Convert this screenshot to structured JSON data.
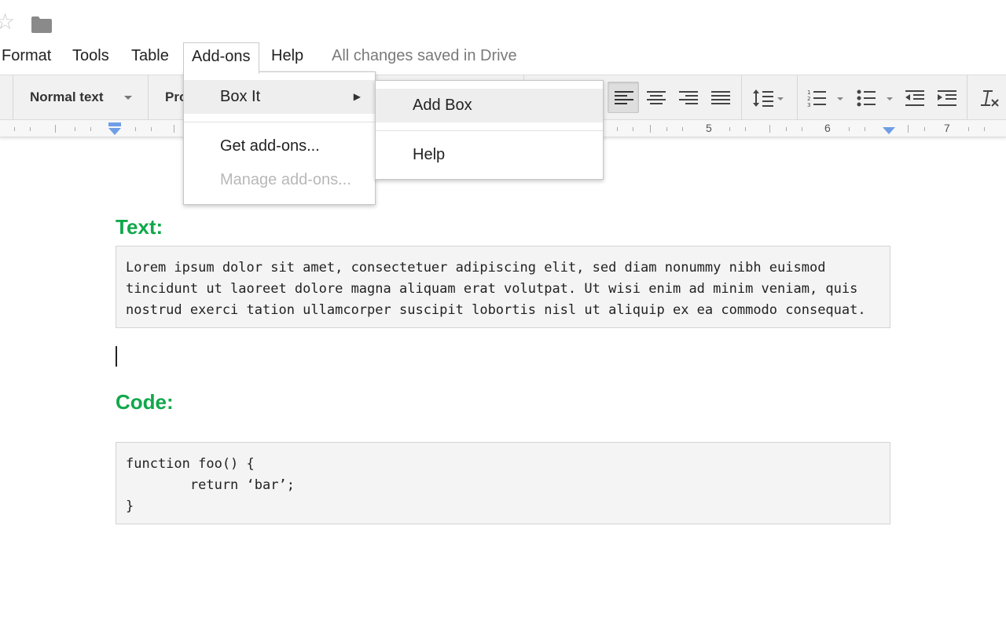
{
  "title_strip": {
    "star_icon": "star-outline-icon",
    "folder_icon": "folder-icon"
  },
  "menubar": {
    "items": [
      {
        "label": "Format"
      },
      {
        "label": "Tools"
      },
      {
        "label": "Table"
      },
      {
        "label": "Add-ons"
      },
      {
        "label": "Help"
      }
    ],
    "active_item": "Add-ons",
    "save_status": "All changes saved in Drive"
  },
  "toolbar": {
    "paragraph_style": "Normal text",
    "font": "Pro",
    "active_alignment": "align-left"
  },
  "ruler": {
    "numbers": [
      "5",
      "6",
      "7"
    ]
  },
  "addons_menu": {
    "items": [
      {
        "label": "Box It",
        "has_submenu": true,
        "highlighted": true
      },
      {
        "label": "Get add-ons..."
      },
      {
        "label": "Manage add-ons...",
        "disabled": true
      }
    ]
  },
  "boxit_submenu": {
    "items": [
      {
        "label": "Add Box",
        "highlighted": true
      },
      {
        "label": "Help"
      }
    ]
  },
  "document": {
    "text_heading": "Text:",
    "text_box_lines": [
      "Lorem ipsum dolor sit amet, consectetuer adipiscing elit, sed diam nonummy nibh euismod",
      "tincidunt ut laoreet dolore magna aliquam erat volutpat. Ut wisi enim ad minim veniam, quis",
      "nostrud exerci tation ullamcorper suscipit lobortis nisl ut aliquip ex ea commodo consequat."
    ],
    "code_heading": "Code:",
    "code_box_lines": [
      "function foo() {",
      "        return ‘bar’;",
      "}"
    ]
  },
  "colors": {
    "heading_green": "#10a84b",
    "box_background": "#f4f4f4",
    "toolbar_background": "#f1f1f1"
  }
}
